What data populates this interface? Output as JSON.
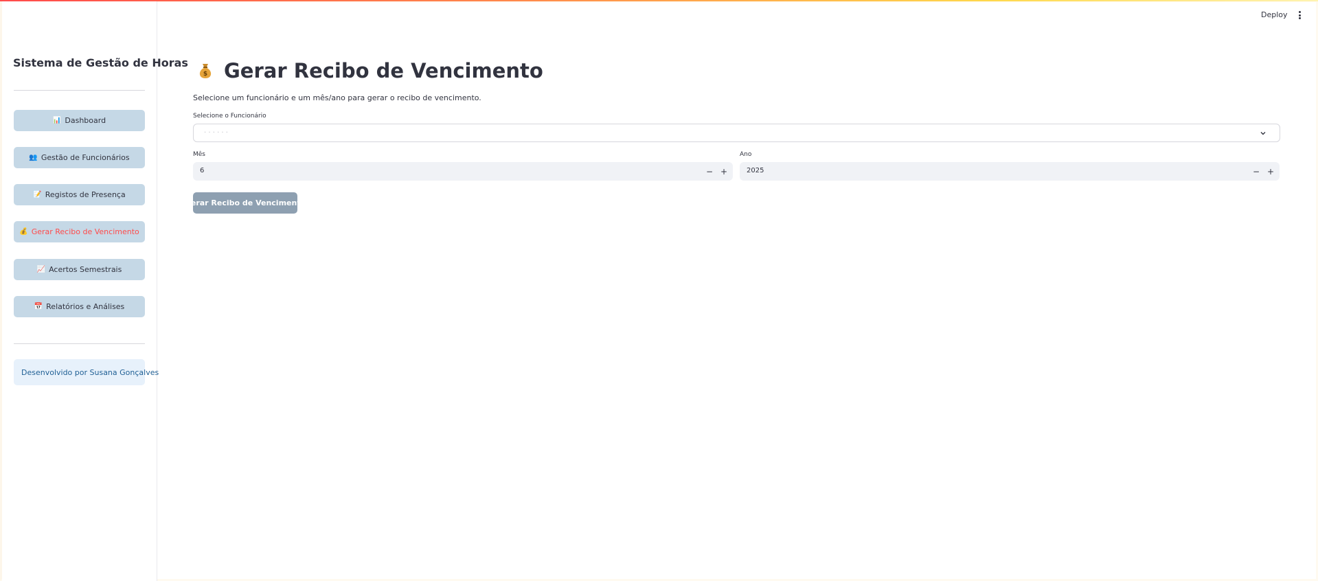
{
  "header": {
    "deploy_label": "Deploy",
    "menu_icon": "kebab-menu-icon"
  },
  "sidebar": {
    "title": "Sistema de Gestão de Horas",
    "items": [
      {
        "icon": "📊",
        "label": "Dashboard",
        "active": false
      },
      {
        "icon": "👥",
        "label": "Gestão de Funcionários",
        "active": false
      },
      {
        "icon": "📝",
        "label": "Registos de Presença",
        "active": false
      },
      {
        "icon": "💰",
        "label": "Gerar Recibo de Vencimento",
        "active": true
      },
      {
        "icon": "📈",
        "label": "Acertos Semestrais",
        "active": false
      },
      {
        "icon": "📅",
        "label": "Relatórios e Análises",
        "active": false
      }
    ],
    "credit": "Desenvolvido por Susana Gonçalves"
  },
  "main": {
    "title": "Gerar Recibo de Vencimento",
    "title_icon": "money-bag-icon",
    "description": "Selecione um funcionário e um mês/ano para gerar o recibo de vencimento.",
    "employee_select": {
      "label": "Selecione o Funcionário",
      "value": "· · · · · ·"
    },
    "month": {
      "label": "Mês",
      "value": "6"
    },
    "year": {
      "label": "Ano",
      "value": "2025"
    },
    "stepper_minus": "−",
    "stepper_plus": "+",
    "submit_label": "Gerar Recibo de Vencimento"
  },
  "colors": {
    "nav_button_bg": "#c5d8e6",
    "active_text": "#ff4b4b",
    "primary_button_bg": "#8ea0b1",
    "credit_bg": "#e7f1fb",
    "credit_text": "#1f5f94"
  }
}
